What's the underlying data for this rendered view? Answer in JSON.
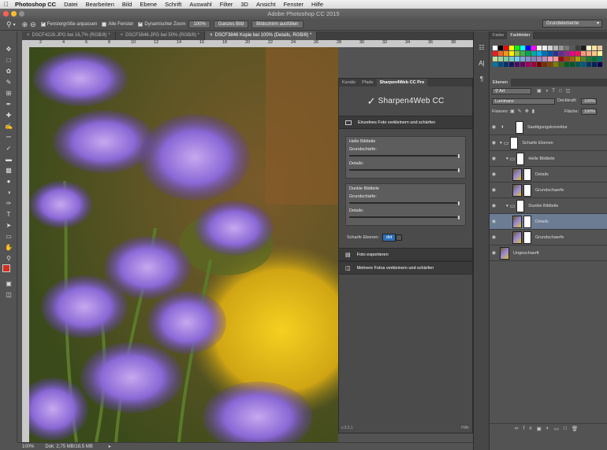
{
  "menubar": {
    "app": "Photoshop CC",
    "items": [
      "Datei",
      "Bearbeiten",
      "Bild",
      "Ebene",
      "Schrift",
      "Auswahl",
      "Filter",
      "3D",
      "Ansicht",
      "Fenster",
      "Hilfe"
    ]
  },
  "window": {
    "title": "Adobe Photoshop CC 2015"
  },
  "options": {
    "fit_windows": "Fenstergröße anpassen",
    "all_windows": "Alle Fenster",
    "scrubby_zoom": "Dynamischer Zoom",
    "zoom_btn": "100%",
    "fit_screen": "Ganzes Bild",
    "fill_screen": "Bildschirm ausfüllen"
  },
  "workspace": "Grundelemente",
  "tabs": [
    {
      "label": "DSCF4226.JPG bei 16,7% (RGB/8) *"
    },
    {
      "label": "DSCF3846.JPG bei 50% (RGB/8) *"
    },
    {
      "label": "DSCF3846 Kopie bei 100% (Details, RGB/8) *"
    }
  ],
  "ruler": {
    "ticks": [
      "2",
      "4",
      "6",
      "8",
      "10",
      "12",
      "14",
      "16",
      "18",
      "20",
      "22",
      "24",
      "26",
      "28",
      "30",
      "32",
      "34",
      "36",
      "38"
    ]
  },
  "status": {
    "zoom": "100%",
    "doc": "Dok: 2,75 MB/18,5 MB"
  },
  "plugin": {
    "tabs": [
      "Kanäle",
      "Pfade",
      "Sharpen4Web CC Pro"
    ],
    "logo": "Sharpen4Web CC",
    "single": "Einzelnes Foto verkleinern und schärfen",
    "light_title": "Helle Bildteile",
    "dark_title": "Dunkle Bildteile",
    "sharpness": "Grundschärfe:",
    "details": "Details:",
    "sharp_layers_label": "Scharfe Ebenen:",
    "sharp_layers_value": "dst",
    "export": "Foto exportieren",
    "multi": "Mehrere Fotos verkleinern und schärfen",
    "version": "v.3.5.1",
    "help": "Hilfe"
  },
  "swatches": {
    "tabs": [
      "Farbe",
      "Farbfelder"
    ],
    "colors": [
      "#ffffff",
      "#000000",
      "#ff0000",
      "#ffff00",
      "#00ff00",
      "#00ffff",
      "#0000ff",
      "#ff00ff",
      "#f5f0e6",
      "#ebebeb",
      "#d2d2d2",
      "#b4b4b4",
      "#969696",
      "#787878",
      "#5a5a5a",
      "#3c3c3c",
      "#1e1e1e",
      "#fff8c8",
      "#ffe1a0",
      "#e8c9a0",
      "#ed1c24",
      "#f26522",
      "#f7941d",
      "#fff200",
      "#8dc63f",
      "#39b54a",
      "#00a651",
      "#00a99d",
      "#00aeef",
      "#0072bc",
      "#0054a6",
      "#2e3192",
      "#662d91",
      "#92278f",
      "#ec008c",
      "#ed145b",
      "#f69679",
      "#f9ad81",
      "#fdc689",
      "#fff799",
      "#c4df9b",
      "#a3d39c",
      "#82ca9c",
      "#7accc8",
      "#6dcff6",
      "#7da7d9",
      "#8393ca",
      "#8781bd",
      "#a186be",
      "#bd8cbf",
      "#f49ac1",
      "#f5989d",
      "#9e0b0f",
      "#a0410d",
      "#a36209",
      "#aba000",
      "#598527",
      "#1a7b30",
      "#007236",
      "#00746b",
      "#0076a3",
      "#004b80",
      "#003471",
      "#1b1464",
      "#440e62",
      "#630460",
      "#9e005d",
      "#9e0039",
      "#790000",
      "#7b2e00",
      "#7d4900",
      "#827b00",
      "#406618",
      "#005e20",
      "#005826",
      "#005952",
      "#005b7f",
      "#003663",
      "#002157",
      "#0d004c"
    ]
  },
  "layers": {
    "title": "Ebenen",
    "filter": "Art",
    "blend": "Luminanz",
    "opacity_label": "Deckkraft:",
    "opacity": "100%",
    "lock_label": "Fixieren:",
    "fill_label": "Fläche:",
    "fill": "100%",
    "items": [
      {
        "name": "Saettigungskorrektur"
      },
      {
        "name": "Scharfe Ebenen"
      },
      {
        "name": "Helle Bildteile"
      },
      {
        "name": "Details"
      },
      {
        "name": "Grundschaerfe"
      },
      {
        "name": "Dunkle Bildteile"
      },
      {
        "name": "Details"
      },
      {
        "name": "Grundschaerfe"
      },
      {
        "name": "Ungeschaerft"
      }
    ]
  }
}
